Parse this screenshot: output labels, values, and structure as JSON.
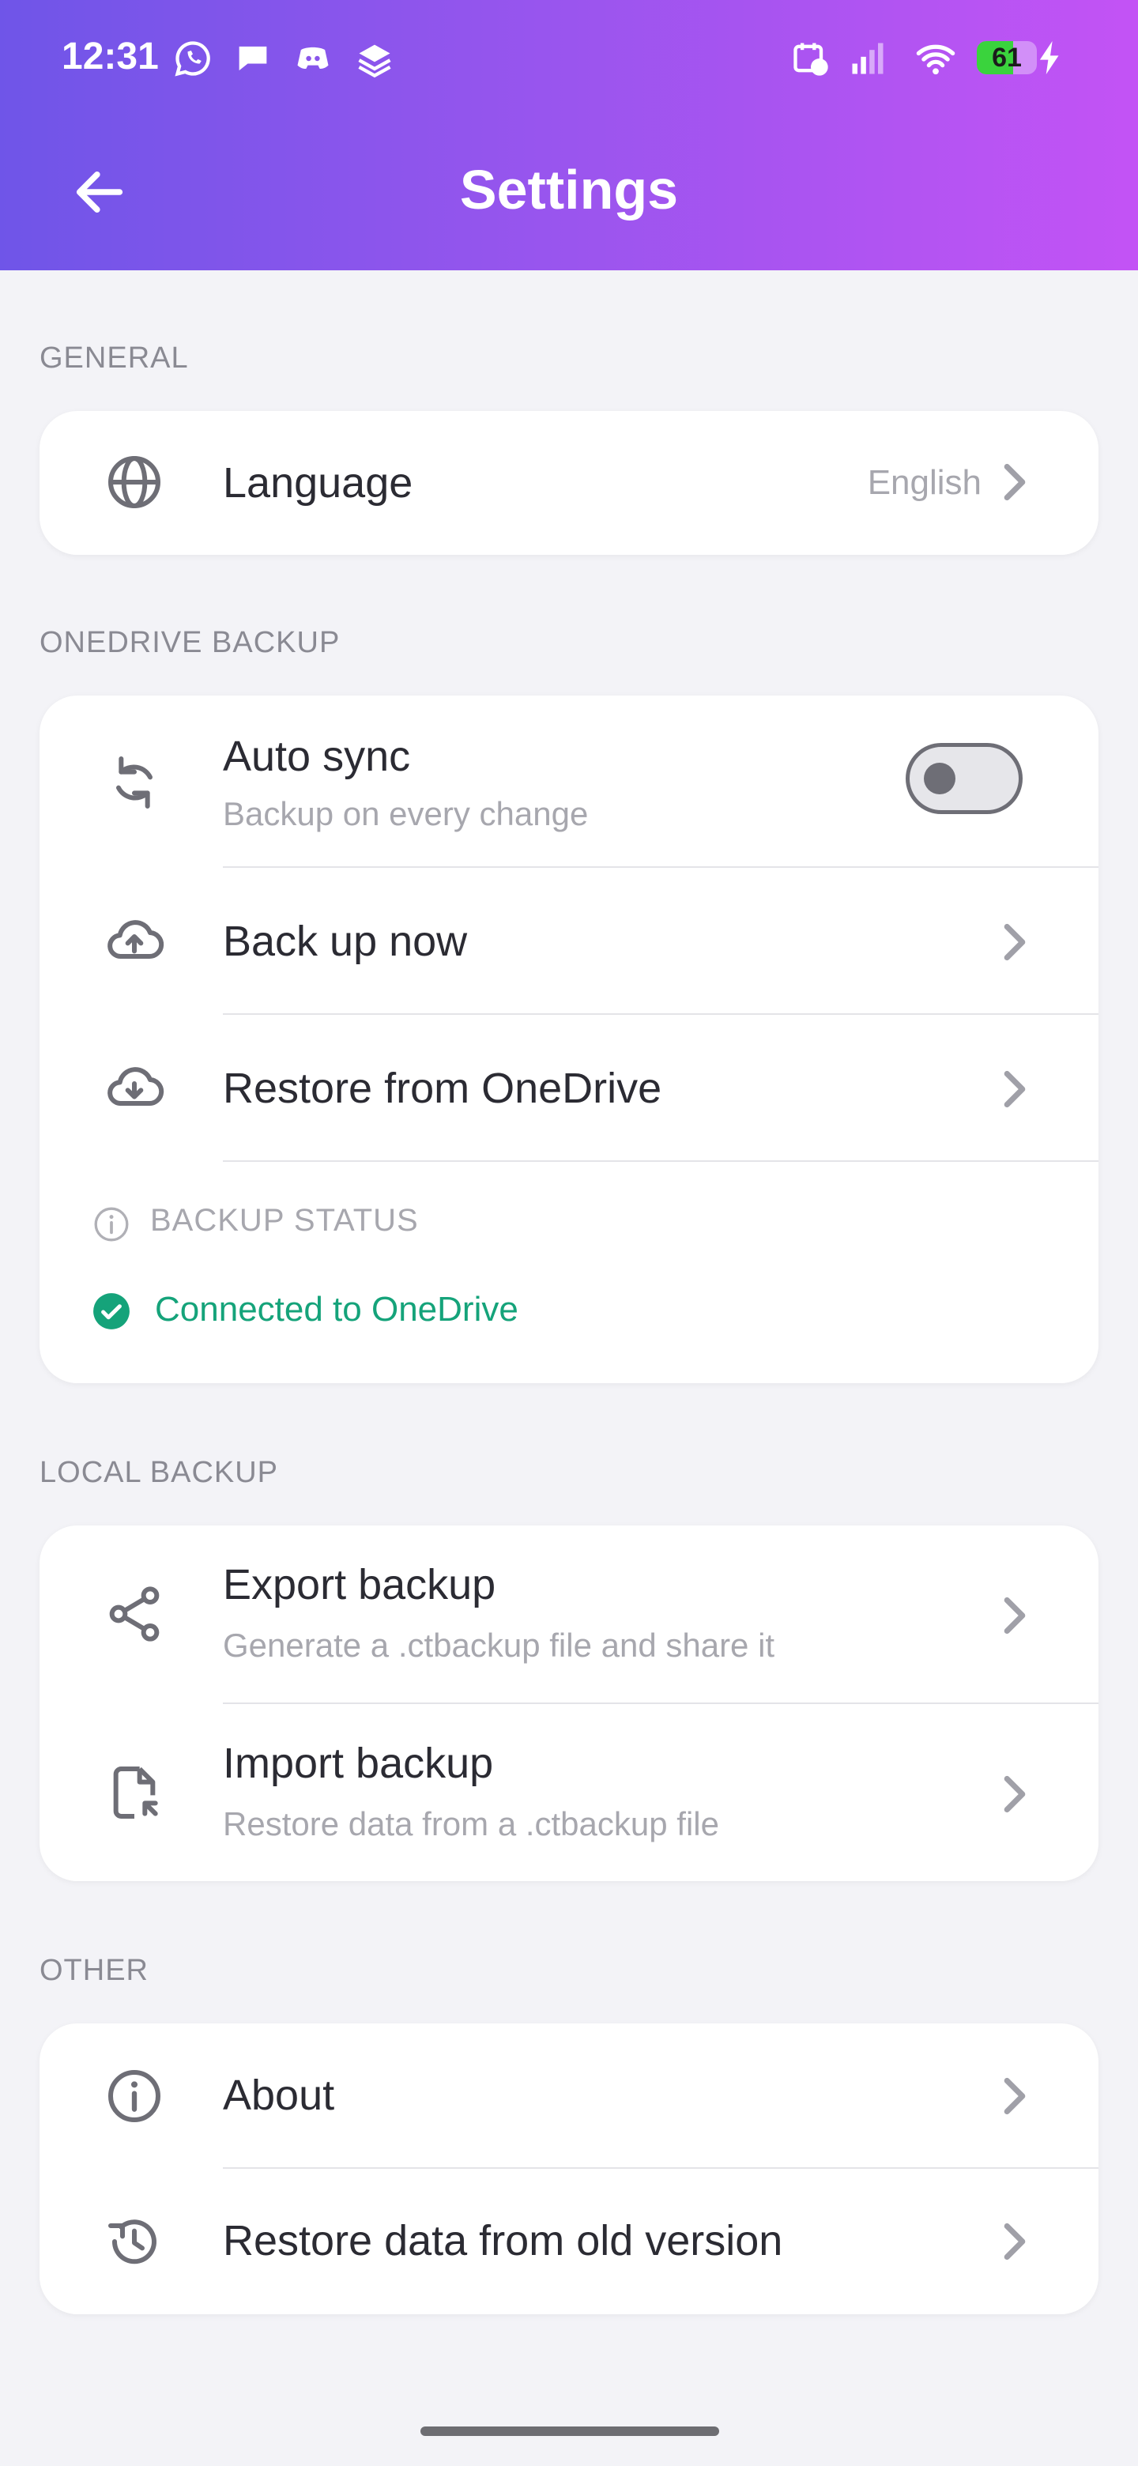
{
  "status_bar": {
    "time": "12:31",
    "battery_level": 61,
    "battery_text": "61",
    "icons": [
      "whatsapp-icon",
      "chat-bubble-icon",
      "discord-icon",
      "layers-app-icon",
      "calendar-alarm-icon",
      "signal-icon",
      "wifi-icon",
      "battery-icon",
      "charging-bolt-icon"
    ]
  },
  "header": {
    "title": "Settings",
    "back_icon": "arrow-left-icon"
  },
  "colors": {
    "header_gradient_start": "#6f55e8",
    "header_gradient_end": "#c353f5",
    "success": "#15a37a",
    "background": "#f3f3f7"
  },
  "general": {
    "label": "GENERAL",
    "language": {
      "title": "Language",
      "value": "English",
      "icon": "globe-icon"
    }
  },
  "onedrive": {
    "label": "ONEDRIVE BACKUP",
    "auto_sync": {
      "title": "Auto sync",
      "subtitle": "Backup on every change",
      "enabled": false,
      "icon": "sync-icon"
    },
    "backup_now": {
      "title": "Back up now",
      "icon": "cloud-upload-icon"
    },
    "restore": {
      "title": "Restore from OneDrive",
      "icon": "cloud-download-icon"
    },
    "status_heading": "BACKUP STATUS",
    "status_text": "Connected to OneDrive"
  },
  "local": {
    "label": "LOCAL BACKUP",
    "export": {
      "title": "Export backup",
      "subtitle": "Generate a .ctbackup file and share it",
      "icon": "share-icon"
    },
    "import": {
      "title": "Import backup",
      "subtitle": "Restore data from a .ctbackup file",
      "icon": "file-import-icon"
    }
  },
  "other": {
    "label": "OTHER",
    "about": {
      "title": "About",
      "icon": "info-icon"
    },
    "restore_old": {
      "title": "Restore data from old version",
      "icon": "history-icon"
    }
  }
}
